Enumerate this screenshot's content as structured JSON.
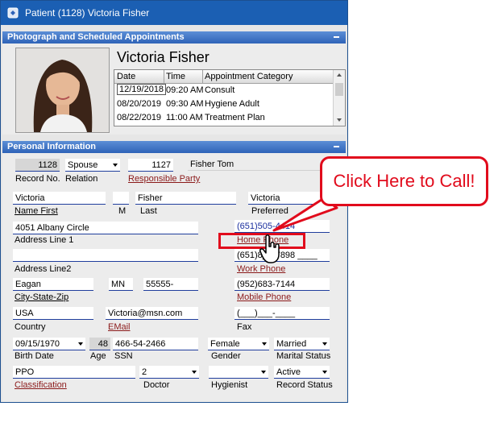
{
  "window": {
    "title": "Patient (1128) Victoria Fisher"
  },
  "sections": {
    "photo": "Photograph and Scheduled Appointments",
    "personal": "Personal Information"
  },
  "patient_name": "Victoria Fisher",
  "appointments": {
    "columns": [
      "Date",
      "Time",
      "Appointment Category"
    ],
    "rows": [
      {
        "date": "12/19/2018",
        "time": "09:20 AM",
        "category": "Consult"
      },
      {
        "date": "08/20/2019",
        "time": "09:30 AM",
        "category": "Hygiene Adult"
      },
      {
        "date": "08/22/2019",
        "time": "11:00 AM",
        "category": "Treatment Plan"
      }
    ]
  },
  "personal": {
    "record_no": "1128",
    "record_no_label": "Record No.",
    "relation": "Spouse",
    "relation_label": "Relation",
    "resp_party_no": "1127",
    "resp_party_name": "Fisher Tom",
    "resp_party_label": "Responsible Party",
    "first_name": "Victoria",
    "name_first_label": "Name First",
    "middle": "",
    "middle_label": "M",
    "last_name": "Fisher",
    "last_label": "Last",
    "preferred": "Victoria",
    "preferred_label": "Preferred",
    "address1": "4051 Albany Circle",
    "address1_label": "Address Line 1",
    "address2": "",
    "address2_label": "Address Line2",
    "home_phone": "(651)505-4414",
    "home_phone_label": "Home Phone",
    "work_phone": "(651)8__-7898 ____",
    "work_phone_label": "Work Phone",
    "city": "Eagan",
    "state": "MN",
    "zip": "55555-",
    "csz_label": "City-State-Zip",
    "mobile_phone": "(952)683-7144",
    "mobile_phone_label": "Mobile Phone",
    "country": "USA",
    "country_label": "Country",
    "email": "Victoria@msn.com",
    "email_label": "EMail",
    "fax": "(___)___-____",
    "fax_label": "Fax",
    "birth_date": "09/15/1970",
    "birth_date_label": "Birth Date",
    "age": "48",
    "age_label": "Age",
    "ssn": "466-54-2466",
    "ssn_label": "SSN",
    "gender": "Female",
    "gender_label": "Gender",
    "marital": "Married",
    "marital_label": "Marital Status",
    "classification": "PPO",
    "classification_label": "Classification",
    "doctor": "2",
    "doctor_label": "Doctor",
    "hygienist": "",
    "hygienist_label": "Hygienist",
    "record_status": "Active",
    "record_status_label": "Record Status"
  },
  "callout": {
    "text": "Click Here to Call!"
  },
  "colors": {
    "title_bar": "#1b5fb3",
    "callout_red": "#e10b1c",
    "link": "#8b1a1a",
    "phone_blue": "#1a2e9e"
  }
}
